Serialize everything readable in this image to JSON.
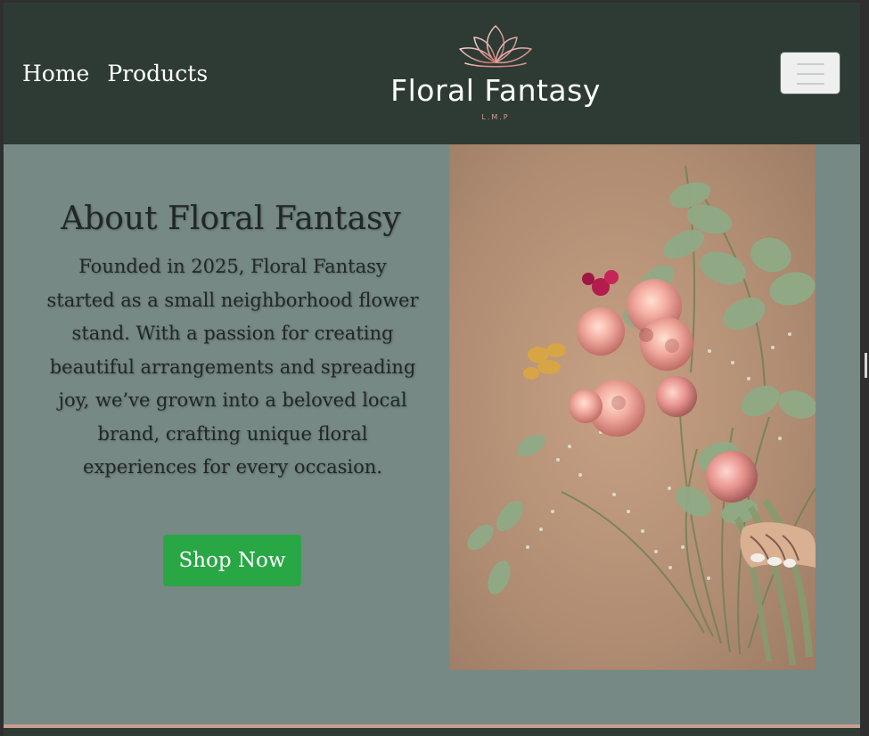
{
  "navbar": {
    "links": [
      "Home",
      "Products"
    ],
    "menu_icon": "hamburger-menu-icon"
  },
  "logo": {
    "title": "Floral Fantasy",
    "subtitle": "L.M.P",
    "icon": "lotus-icon"
  },
  "about": {
    "title": "About Floral Fantasy",
    "text": "Founded in 2025, Floral Fantasy started as a small neighborhood flower stand. With a passion for creating beautiful arrangements and spreading joy, we’ve grown into a beloved local brand, crafting unique floral experiences for every occasion.",
    "button_label": "Shop Now"
  },
  "colors": {
    "navbar": "#2d3b34",
    "background": "#778985",
    "button": "#29a745",
    "accent": "#d79b8f"
  }
}
